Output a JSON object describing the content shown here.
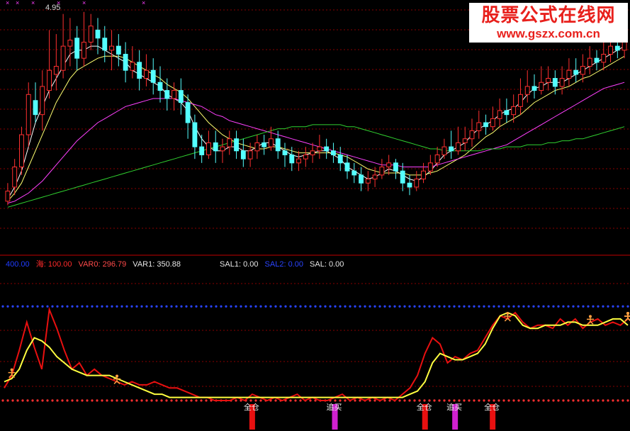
{
  "watermark": {
    "title": "股票公式在线网",
    "url": "www.gszx.com.cn"
  },
  "top_panel": {
    "peak_label": "4.95"
  },
  "indicator_legend": [
    {
      "key": "v400",
      "text": "400.00",
      "color": "#1f3cff"
    },
    {
      "key": "hai",
      "text": "海: 100.00",
      "color": "#ff2a2a"
    },
    {
      "key": "var0",
      "text": "VAR0: 296.79",
      "color": "#ff4a4a"
    },
    {
      "key": "var1",
      "text": "VAR1: 350.88",
      "color": "#e6e6e6"
    },
    {
      "key": "sal1",
      "text": "SAL1: 0.00",
      "color": "#e6e6e6"
    },
    {
      "key": "sal2",
      "text": "SAL2: 0.00",
      "color": "#2a44ff"
    },
    {
      "key": "sal",
      "text": "SAL: 0.00",
      "color": "#e6e6e6"
    }
  ],
  "signal_labels": {
    "full": "全仓",
    "chase": "追买"
  },
  "colors": {
    "up": "#ff3030",
    "down": "#54ffff",
    "ma_fast": "#ffffff",
    "ma_mid": "#ffff70",
    "ma_slow": "#ff40ff",
    "ma_long": "#30d030",
    "osc_red": "#e81010",
    "osc_yellow": "#ffff40"
  },
  "chart_data": [
    {
      "type": "candlestick",
      "ylim": [
        0,
        100
      ],
      "candles": [
        [
          5,
          10,
          14,
          3
        ],
        [
          12,
          22,
          26,
          8
        ],
        [
          22,
          38,
          42,
          18
        ],
        [
          38,
          58,
          64,
          32
        ],
        [
          55,
          48,
          64,
          44
        ],
        [
          48,
          62,
          70,
          40
        ],
        [
          60,
          70,
          90,
          56
        ],
        [
          68,
          72,
          88,
          60
        ],
        [
          70,
          82,
          98,
          66
        ],
        [
          82,
          85,
          96,
          72
        ],
        [
          86,
          76,
          92,
          70
        ],
        [
          76,
          84,
          99,
          72
        ],
        [
          84,
          92,
          98,
          80
        ],
        [
          90,
          86,
          96,
          78
        ],
        [
          86,
          80,
          92,
          74
        ],
        [
          80,
          82,
          90,
          70
        ],
        [
          82,
          78,
          88,
          72
        ],
        [
          78,
          70,
          84,
          64
        ],
        [
          70,
          74,
          82,
          66
        ],
        [
          74,
          66,
          80,
          60
        ],
        [
          66,
          70,
          78,
          62
        ],
        [
          70,
          64,
          76,
          58
        ],
        [
          64,
          60,
          72,
          54
        ],
        [
          60,
          56,
          66,
          50
        ],
        [
          56,
          60,
          64,
          50
        ],
        [
          60,
          54,
          66,
          48
        ],
        [
          54,
          44,
          58,
          36
        ],
        [
          44,
          32,
          48,
          26
        ],
        [
          32,
          28,
          38,
          24
        ],
        [
          28,
          34,
          40,
          26
        ],
        [
          34,
          30,
          40,
          24
        ],
        [
          30,
          32,
          36,
          24
        ],
        [
          32,
          36,
          40,
          28
        ],
        [
          36,
          30,
          40,
          26
        ],
        [
          30,
          26,
          36,
          22
        ],
        [
          26,
          30,
          34,
          22
        ],
        [
          30,
          34,
          38,
          26
        ],
        [
          34,
          32,
          38,
          28
        ],
        [
          32,
          36,
          42,
          30
        ],
        [
          36,
          30,
          40,
          26
        ],
        [
          30,
          28,
          34,
          22
        ],
        [
          28,
          24,
          32,
          20
        ],
        [
          24,
          26,
          30,
          20
        ],
        [
          26,
          28,
          32,
          22
        ],
        [
          28,
          30,
          34,
          24
        ],
        [
          30,
          32,
          38,
          26
        ],
        [
          32,
          30,
          36,
          26
        ],
        [
          30,
          28,
          34,
          24
        ],
        [
          28,
          24,
          32,
          20
        ],
        [
          24,
          20,
          28,
          16
        ],
        [
          20,
          18,
          24,
          14
        ],
        [
          18,
          14,
          22,
          10
        ],
        [
          14,
          16,
          20,
          10
        ],
        [
          16,
          18,
          22,
          12
        ],
        [
          18,
          22,
          26,
          16
        ],
        [
          22,
          24,
          28,
          18
        ],
        [
          24,
          20,
          26,
          16
        ],
        [
          20,
          14,
          24,
          10
        ],
        [
          14,
          12,
          18,
          8
        ],
        [
          12,
          16,
          20,
          10
        ],
        [
          16,
          20,
          24,
          14
        ],
        [
          20,
          24,
          28,
          18
        ],
        [
          24,
          28,
          32,
          22
        ],
        [
          28,
          32,
          36,
          26
        ],
        [
          32,
          30,
          40,
          26
        ],
        [
          30,
          34,
          42,
          28
        ],
        [
          34,
          36,
          42,
          30
        ],
        [
          36,
          40,
          46,
          32
        ],
        [
          40,
          44,
          50,
          36
        ],
        [
          44,
          42,
          48,
          38
        ],
        [
          42,
          46,
          52,
          40
        ],
        [
          46,
          50,
          56,
          42
        ],
        [
          50,
          48,
          56,
          44
        ],
        [
          48,
          52,
          58,
          44
        ],
        [
          52,
          58,
          66,
          48
        ],
        [
          58,
          62,
          70,
          54
        ],
        [
          62,
          60,
          68,
          56
        ],
        [
          60,
          64,
          72,
          58
        ],
        [
          64,
          66,
          72,
          60
        ],
        [
          66,
          62,
          70,
          58
        ],
        [
          62,
          66,
          72,
          58
        ],
        [
          66,
          70,
          76,
          62
        ],
        [
          70,
          68,
          76,
          64
        ],
        [
          68,
          72,
          78,
          64
        ],
        [
          72,
          76,
          82,
          68
        ],
        [
          76,
          74,
          80,
          70
        ],
        [
          74,
          78,
          86,
          70
        ],
        [
          78,
          82,
          92,
          74
        ],
        [
          82,
          80,
          88,
          76
        ],
        [
          80,
          86,
          94,
          76
        ]
      ],
      "moving_averages": [
        {
          "name": "MA5",
          "values": [
            6,
            12,
            20,
            32,
            44,
            52,
            60,
            66,
            72,
            78,
            80,
            80,
            82,
            82,
            80,
            78,
            76,
            74,
            70,
            68,
            66,
            64,
            62,
            58,
            56,
            54,
            50,
            42,
            36,
            32,
            30,
            30,
            32,
            32,
            30,
            30,
            32,
            34,
            34,
            32,
            30,
            28,
            27,
            28,
            29,
            30,
            30,
            28,
            26,
            22,
            20,
            18,
            16,
            17,
            19,
            21,
            20,
            18,
            16,
            15,
            17,
            20,
            24,
            28,
            30,
            32,
            34,
            38,
            41,
            43,
            45,
            48,
            50,
            51,
            54,
            58,
            61,
            62,
            64,
            64,
            64,
            66,
            68,
            70,
            72,
            74,
            76,
            78,
            80,
            82
          ]
        },
        {
          "name": "MA10",
          "values": [
            5,
            9,
            14,
            22,
            30,
            38,
            46,
            54,
            60,
            66,
            70,
            72,
            74,
            76,
            77,
            77,
            77,
            76,
            74,
            72,
            70,
            68,
            66,
            63,
            61,
            59,
            56,
            52,
            48,
            44,
            41,
            38,
            36,
            34,
            33,
            32,
            31,
            31,
            32,
            32,
            31,
            30,
            29,
            29,
            29,
            29,
            29,
            29,
            28,
            27,
            25,
            23,
            21,
            20,
            19,
            19,
            19,
            19,
            18,
            18,
            18,
            19,
            20,
            22,
            24,
            26,
            28,
            31,
            34,
            37,
            39,
            42,
            44,
            46,
            48,
            51,
            54,
            56,
            58,
            60,
            61,
            62,
            64,
            66,
            67,
            69,
            71,
            73,
            75,
            77
          ]
        },
        {
          "name": "MA30",
          "values": [
            4,
            5,
            7,
            9,
            12,
            15,
            19,
            23,
            27,
            31,
            35,
            38,
            41,
            44,
            46,
            48,
            50,
            52,
            53,
            54,
            55,
            56,
            56,
            56,
            56,
            55,
            54,
            53,
            52,
            50,
            48,
            47,
            45,
            44,
            43,
            42,
            41,
            40,
            39,
            38,
            37,
            36,
            35,
            34,
            33,
            32,
            31,
            30,
            29,
            28,
            27,
            26,
            25,
            24,
            23,
            23,
            23,
            22,
            22,
            22,
            22,
            22,
            23,
            24,
            25,
            26,
            27,
            28,
            29,
            30,
            31,
            32,
            33,
            35,
            37,
            39,
            41,
            43,
            45,
            47,
            49,
            51,
            53,
            55,
            57,
            59,
            61,
            62,
            63,
            64
          ]
        },
        {
          "name": "MA60",
          "values": [
            2,
            3,
            4,
            5,
            6,
            7,
            8,
            9,
            10,
            11,
            12,
            13,
            14,
            15,
            16,
            17,
            18,
            19,
            20,
            21,
            22,
            23,
            24,
            25,
            26,
            27,
            28,
            29,
            30,
            31,
            32,
            33,
            34,
            35,
            36,
            37,
            38,
            39,
            40,
            41,
            41,
            42,
            42,
            42,
            43,
            43,
            43,
            43,
            43,
            42,
            42,
            41,
            40,
            39,
            38,
            37,
            36,
            35,
            34,
            33,
            32,
            31,
            31,
            30,
            30,
            30,
            30,
            30,
            30,
            31,
            31,
            31,
            32,
            32,
            32,
            33,
            33,
            33,
            34,
            34,
            35,
            35,
            36,
            36,
            37,
            38,
            39,
            40,
            41,
            42
          ]
        }
      ]
    },
    {
      "type": "line",
      "ylim": [
        0,
        400
      ],
      "reference_lines": [
        {
          "name": "upper",
          "y": 300
        },
        {
          "name": "lower",
          "y": 0
        }
      ],
      "series": [
        {
          "name": "海",
          "values": [
            40,
            80,
            160,
            250,
            170,
            100,
            290,
            230,
            160,
            100,
            120,
            80,
            100,
            80,
            70,
            60,
            50,
            60,
            50,
            50,
            60,
            50,
            40,
            40,
            30,
            20,
            10,
            10,
            0,
            0,
            0,
            10,
            0,
            20,
            10,
            0,
            10,
            0,
            10,
            20,
            0,
            10,
            0,
            0,
            10,
            20,
            0,
            10,
            0,
            10,
            0,
            10,
            0,
            20,
            40,
            80,
            150,
            200,
            180,
            120,
            140,
            130,
            150,
            160,
            200,
            240,
            270,
            260,
            280,
            250,
            230,
            240,
            240,
            230,
            260,
            240,
            260,
            230,
            250,
            260,
            240,
            250,
            240,
            260
          ]
        },
        {
          "name": "VAR1",
          "values": [
            60,
            70,
            100,
            160,
            200,
            190,
            170,
            140,
            120,
            100,
            90,
            80,
            80,
            80,
            80,
            70,
            60,
            50,
            40,
            30,
            20,
            20,
            10,
            10,
            10,
            10,
            10,
            10,
            10,
            10,
            10,
            10,
            10,
            10,
            10,
            10,
            10,
            10,
            10,
            10,
            10,
            10,
            10,
            10,
            10,
            10,
            10,
            10,
            10,
            10,
            10,
            10,
            10,
            10,
            20,
            30,
            60,
            120,
            150,
            140,
            130,
            130,
            140,
            150,
            180,
            230,
            270,
            280,
            270,
            240,
            230,
            230,
            240,
            240,
            240,
            250,
            250,
            240,
            240,
            240,
            250,
            260,
            260,
            240
          ]
        }
      ],
      "markers": [
        {
          "label": "全仓",
          "x": 33
        },
        {
          "label": "追买",
          "x": 44
        },
        {
          "label": "全仓",
          "x": 56
        },
        {
          "label": "追买",
          "x": 60
        },
        {
          "label": "全仓",
          "x": 65
        }
      ]
    }
  ]
}
